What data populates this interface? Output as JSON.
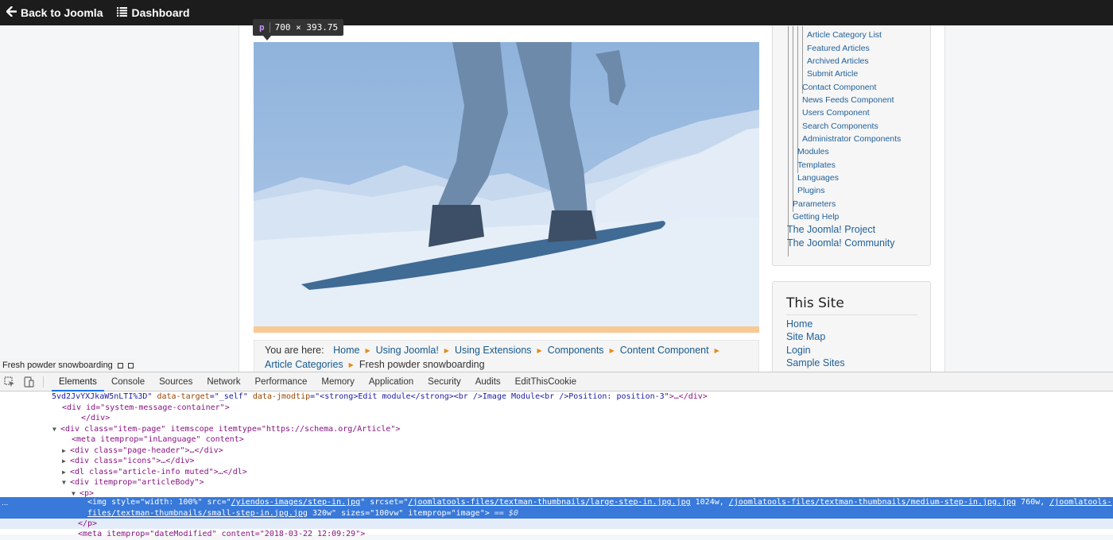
{
  "topbar": {
    "back_label": "Back to Joomla",
    "dashboard_label": "Dashboard"
  },
  "tooltip": {
    "tag": "p",
    "dims": "700 × 393.75"
  },
  "breadcrumb": {
    "prefix": "You are here:",
    "items": [
      "Home",
      "Using Joomla!",
      "Using Extensions",
      "Components",
      "Content Component",
      "Article Categories"
    ],
    "current": "Fresh powder snowboarding"
  },
  "menu": {
    "items": [
      "Article Category List",
      "Featured Articles",
      "Archived Articles",
      "Submit Article",
      "Contact Component",
      "News Feeds Component",
      "Users Component",
      "Search Components",
      "Administrator Components",
      "Modules",
      "Templates",
      "Languages",
      "Plugins",
      "Parameters",
      "Getting Help",
      "The Joomla! Project",
      "The Joomla! Community"
    ]
  },
  "site": {
    "title": "This Site",
    "links": [
      "Home",
      "Site Map",
      "Login",
      "Sample Sites"
    ]
  },
  "image_caption": "Fresh powder snowboarding",
  "devtools": {
    "tabs": [
      "Elements",
      "Console",
      "Sources",
      "Network",
      "Performance",
      "Memory",
      "Application",
      "Security",
      "Audits",
      "EditThisCookie"
    ],
    "active_tab": "Elements",
    "code": {
      "l0_a": "5vd2JvYXJkaW5nLTI%3D\"",
      "l0_b": " data-target",
      "l0_c": "=\"_self\"",
      "l0_d": " data-jmodtip",
      "l0_e": "=\"<strong>Edit module</strong><br />Image Module<br />Position: position-3\"",
      "l0_f": ">…</div>",
      "l1": "<div id=\"system-message-container\">",
      "l2": "</div>",
      "l3": "<div class=\"item-page\" itemscope itemtype=\"https://schema.org/Article\">",
      "l4": "<meta itemprop=\"inLanguage\" content>",
      "l5": "<div class=\"page-header\">…</div>",
      "l6": "<div class=\"icons\">…</div>",
      "l7": "<dl class=\"article-info muted\">…</dl>",
      "l8": "<div itemprop=\"articleBody\">",
      "l9": "<p>",
      "sel_a": "<img style=\"width: 100%\" src=\"",
      "sel_src": "/yiendos-images/step-in.jpg",
      "sel_b": "\" srcset=\"",
      "sel_s1": "/joomlatools-files/textman-thumbnails/large-step-in.jpg.jpg",
      "sel_c": " 1024w, ",
      "sel_s2": "/joomlatools-files/textman-thumbnails/medium-step-in.jpg.jpg",
      "sel_d": " 760w, ",
      "sel_s3": "/joomlatools-",
      "sel_s3b": "files/textman-thumbnails/small-step-in.jpg.jpg",
      "sel_e": " 320w\" sizes=\"100vw\" itemprop=\"image\">",
      "sel_eq": " == $0",
      "ellipsis": "...",
      "l11": "</p>",
      "l12": "<meta itemprop=\"dateModified\" content=\"2018-03-22 12:09:29\">"
    }
  }
}
